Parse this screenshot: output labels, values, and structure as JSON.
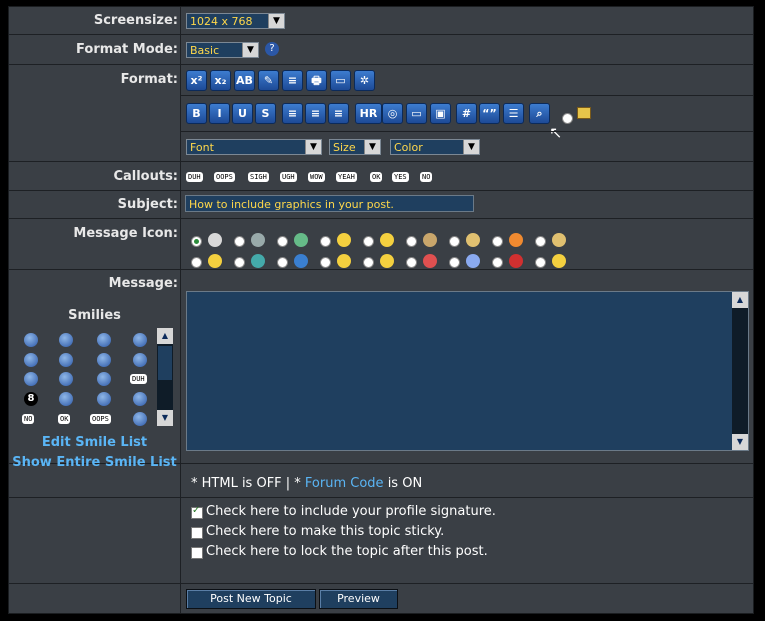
{
  "labels": {
    "screensize": "Screensize:",
    "format_mode": "Format Mode:",
    "format": "Format:",
    "callouts": "Callouts:",
    "subject": "Subject:",
    "message_icon": "Message Icon:",
    "message": "Message:",
    "smilies": "Smilies"
  },
  "screensize": {
    "value": "1024 x 768"
  },
  "format_mode": {
    "value": "Basic"
  },
  "format_toolbar_row1": [
    "x²",
    "x₂",
    "AB",
    "✎",
    "≡",
    "🖶",
    "▭",
    "✲"
  ],
  "format_toolbar_row2": [
    "B",
    "I",
    "U",
    "S",
    "≡",
    "≡",
    "≡",
    "HR",
    "◎",
    "▭",
    "▣",
    "#",
    "“”",
    "☰",
    "⌕"
  ],
  "font_selects": {
    "font": "Font",
    "size": "Size",
    "color": "Color"
  },
  "callouts": [
    "DUH",
    "OOPS",
    "SIGH",
    "UGH",
    "WOW",
    "YEAH",
    "OK",
    "YES",
    "NO"
  ],
  "subject": {
    "value": "How to include graphics in your post."
  },
  "smile_list_links": {
    "edit": "Edit Smile List",
    "show_all": "Show Entire Smile List"
  },
  "smile_bubbles": [
    "DUH",
    "NO",
    "OK",
    "OOPS"
  ],
  "smile_number": "8",
  "forum_code_note": {
    "prefix": "* HTML is OFF | * ",
    "link": "Forum Code",
    "suffix": " is ON"
  },
  "options": [
    {
      "label": "Check here to include your profile signature.",
      "checked": true
    },
    {
      "label": "Check here to make this topic sticky.",
      "checked": false
    },
    {
      "label": "Check here to lock the topic after this post.",
      "checked": false
    }
  ],
  "buttons": {
    "post": "Post New Topic",
    "preview": "Preview"
  },
  "colors": {
    "background": "#3a3f45",
    "input_bg": "#1f3f5f",
    "input_text": "#ffd84a",
    "link": "#5ab5f5"
  }
}
